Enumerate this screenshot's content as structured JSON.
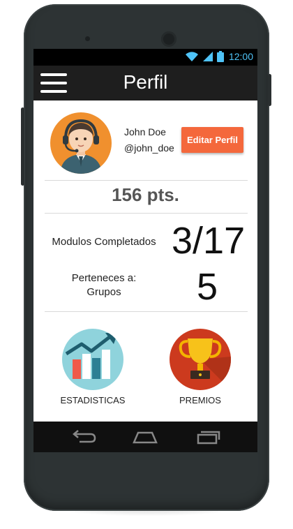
{
  "status_bar": {
    "time": "12:00"
  },
  "app_bar": {
    "title": "Perfil"
  },
  "profile": {
    "name": "John Doe",
    "handle": "@john_doe",
    "edit_button": "Editar Perfil"
  },
  "points": "156 pts.",
  "stats": {
    "modules_label": "Modulos Completados",
    "modules_value": "3/17",
    "groups_label": "Perteneces a:\nGrupos",
    "groups_value": "5"
  },
  "tiles": [
    {
      "label": "ESTADISTICAS"
    },
    {
      "label": "PREMIOS"
    }
  ],
  "colors": {
    "accent": "#f4683c",
    "status_icons": "#4fc3f7",
    "appbar": "#1e1e1e",
    "avatar_bg": "#f0902e",
    "stats_bg": "#8fd3dc",
    "trophy_bg": "#cc3a1e"
  }
}
